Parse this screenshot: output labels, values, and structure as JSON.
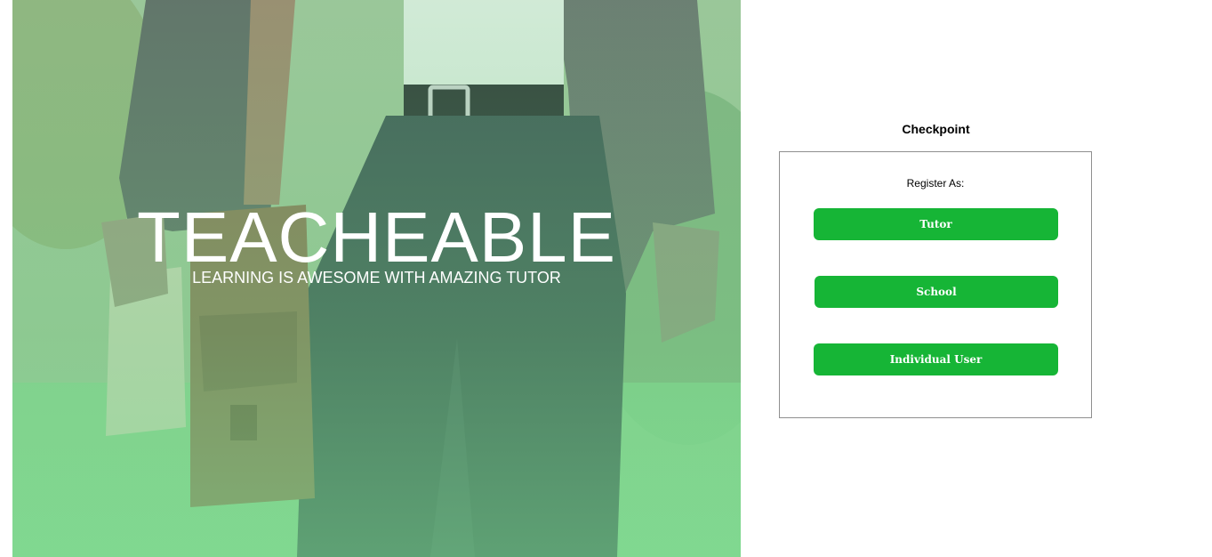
{
  "hero": {
    "title": "TEACHEABLE",
    "subtitle": "LEARNING IS AWESOME WITH AMAZING TUTOR"
  },
  "checkpoint": {
    "title": "Checkpoint",
    "register_label": "Register As:",
    "buttons": {
      "tutor": "Tutor",
      "school": "School",
      "individual": "Individual User"
    }
  },
  "colors": {
    "button_green": "#16b536",
    "hero_tint": "#7fd38e",
    "box_border": "#8f8f8f"
  }
}
